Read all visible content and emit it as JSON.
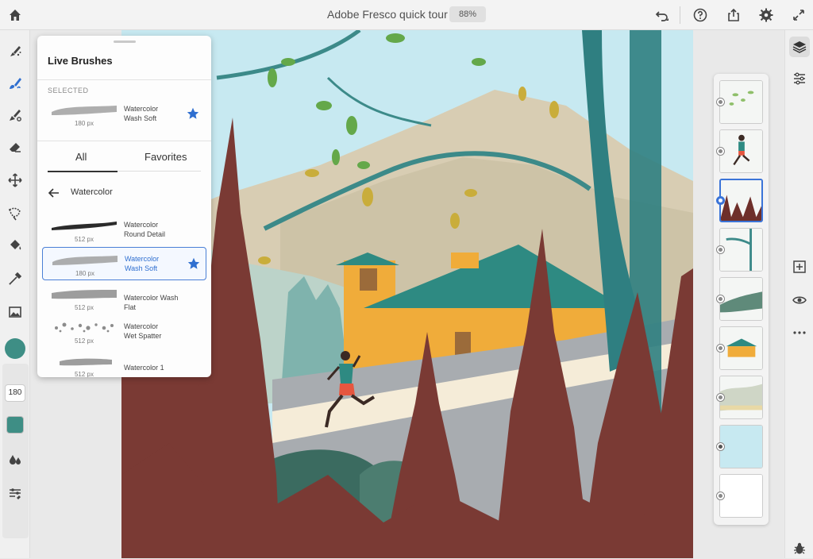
{
  "topbar": {
    "title": "Adobe Fresco quick tour",
    "zoom": "88%",
    "icons": [
      "home-icon",
      "undo-icon",
      "help-icon",
      "share-icon",
      "settings-icon",
      "fullscreen-icon"
    ]
  },
  "left_toolbar": {
    "tools": [
      "pixel-brush-icon",
      "live-brush-icon",
      "vector-brush-icon",
      "eraser-icon",
      "move-transform-icon",
      "lasso-icon",
      "fill-icon",
      "eyedropper-icon",
      "place-image-icon"
    ],
    "active_tool": "live-brush-icon",
    "color": "#3e8e85",
    "brush_size": "180"
  },
  "brushes_panel": {
    "title": "Live Brushes",
    "selected_label": "SELECTED",
    "selected": {
      "name": "Watercolor\nWash Soft",
      "size": "180 px"
    },
    "tabs": [
      "All",
      "Favorites"
    ],
    "active_tab": "All",
    "category": "Watercolor",
    "items": [
      {
        "name": "Watercolor\nRound Detail",
        "size": "512 px"
      },
      {
        "name": "Watercolor\nWash Soft",
        "size": "180 px"
      },
      {
        "name": "Watercolor Wash Flat",
        "size": "512 px"
      },
      {
        "name": "Watercolor\nWet Spatter",
        "size": "512 px"
      },
      {
        "name": "Watercolor 1",
        "size": "512 px"
      }
    ]
  },
  "layers": {
    "count": 9,
    "active_index": 2
  },
  "right_toolbar": {
    "icons": [
      "layers-icon",
      "properties-icon",
      "add-layer-icon",
      "visibility-icon",
      "more-icon",
      "bug-icon"
    ]
  },
  "colors": {
    "accent": "#3b74d8",
    "star": "#2f6fd0",
    "teal": "#3e8e85"
  }
}
